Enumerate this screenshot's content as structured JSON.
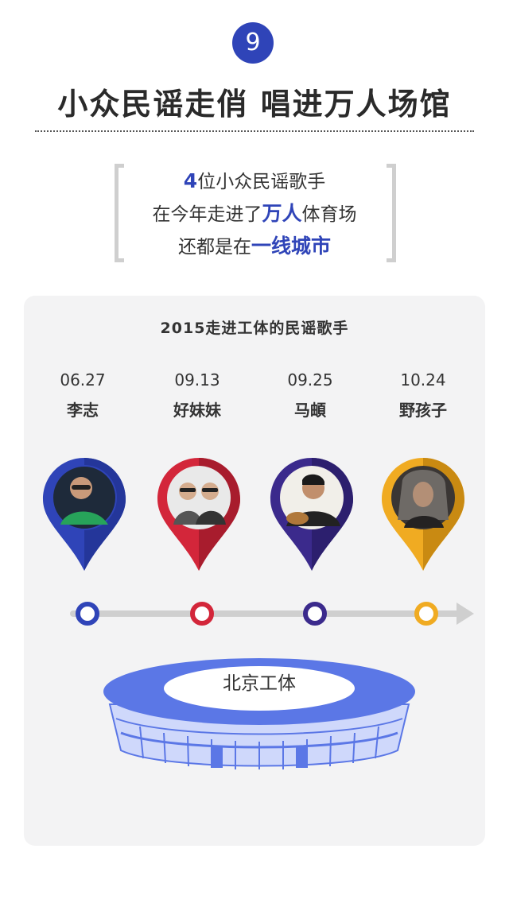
{
  "header": {
    "badge_number": "9",
    "title": "小众民谣走俏 唱进万人场馆"
  },
  "intro": {
    "line1_highlight": "4",
    "line1_text": "位小众民谣歌手",
    "line2_pre": "在今年走进了",
    "line2_highlight": "万人",
    "line2_post": "体育场",
    "line3_pre": "还都是在",
    "line3_highlight": "一线城市"
  },
  "panel": {
    "title": "2015走进工体的民谣歌手",
    "venue": "北京工体"
  },
  "singers": [
    {
      "date": "06.27",
      "name": "李志",
      "color": "#2f44b8"
    },
    {
      "date": "09.13",
      "name": "好妹妹",
      "color": "#d3263a"
    },
    {
      "date": "09.25",
      "name": "马頔",
      "color": "#3b2a8c"
    },
    {
      "date": "10.24",
      "name": "野孩子",
      "color": "#f0ab22"
    }
  ],
  "colors": {
    "accent": "#2f44b8",
    "panel_bg": "#f3f3f4",
    "stadium": "#5b77e6"
  }
}
